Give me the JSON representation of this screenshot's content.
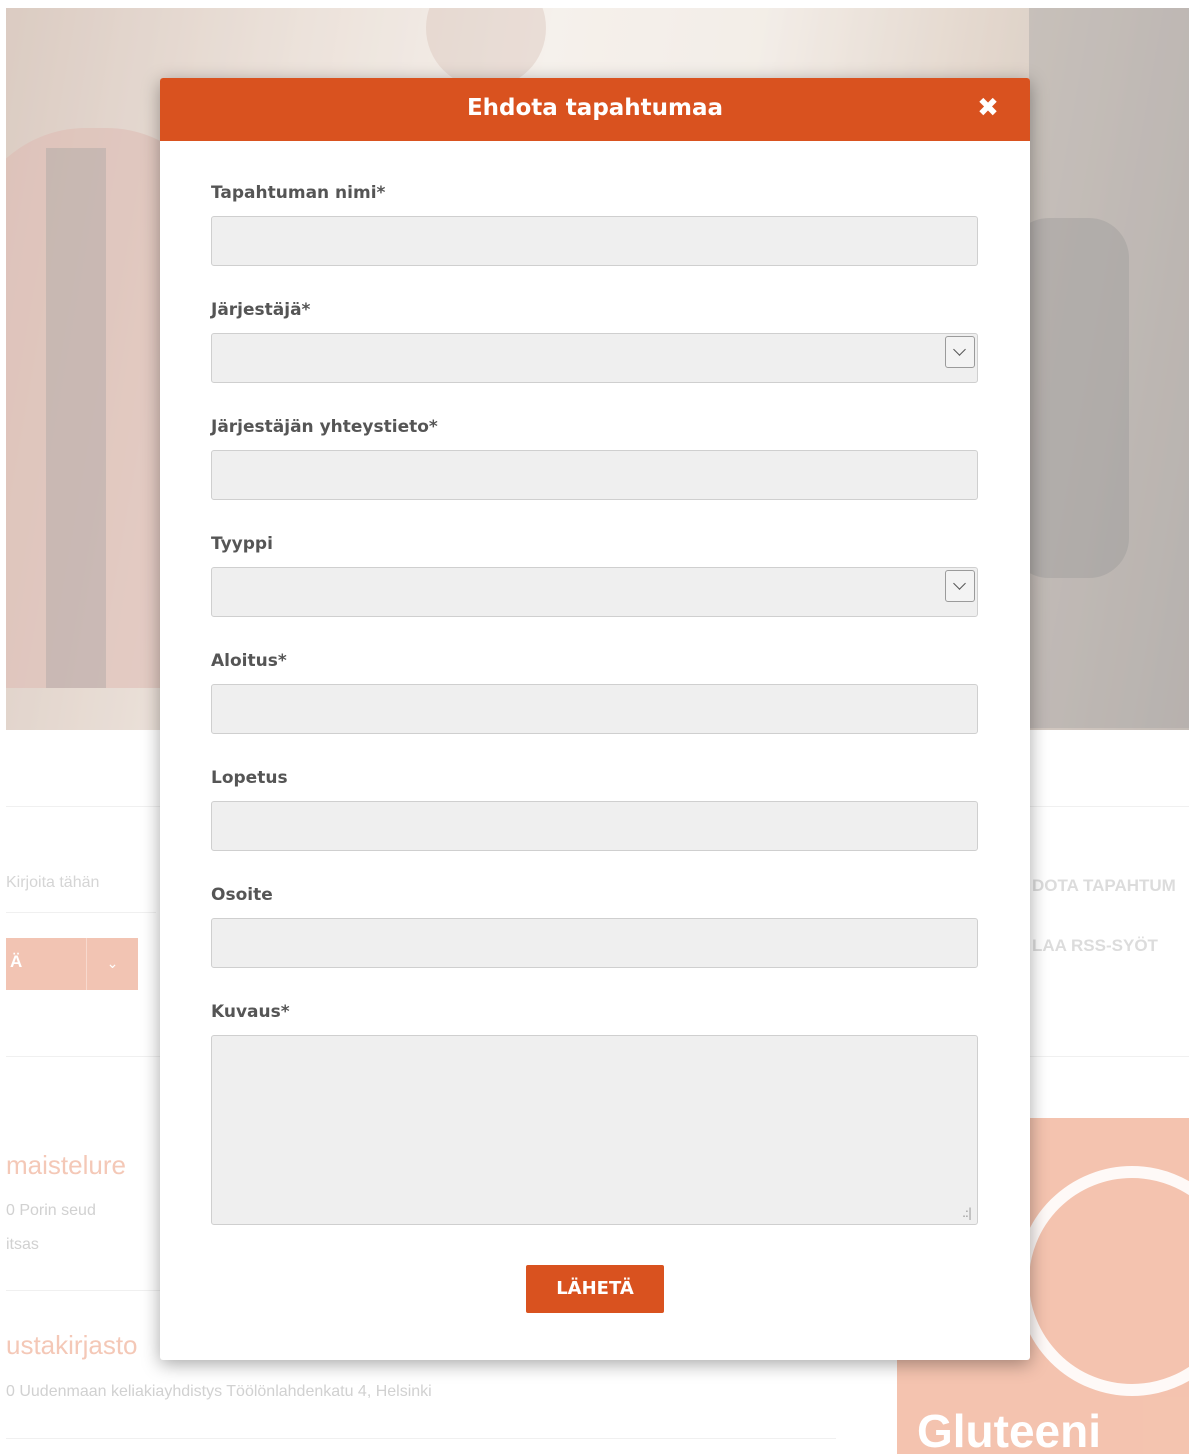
{
  "background": {
    "search_placeholder": "Kirjoita tähän",
    "filter_button_label": "Ä",
    "right_links": [
      "DOTA TAPAHTUM",
      "LAA RSS-SYÖT"
    ],
    "events": [
      {
        "title": "maistelure",
        "meta": "0  Porin seud",
        "meta2": "itsas"
      },
      {
        "title": "ustakirjasto",
        "meta": "0  Uudenmaan keliakiayhdistys   Töölönlahdenkatu 4, Helsinki"
      }
    ],
    "promo_text": "Gluteeni"
  },
  "modal": {
    "title": "Ehdota tapahtumaa",
    "close_glyph": "✖",
    "fields": {
      "name": {
        "label": "Tapahtuman nimi*",
        "value": ""
      },
      "organizer": {
        "label": "Järjestäjä*",
        "value": ""
      },
      "contact": {
        "label": "Järjestäjän yhteystieto*",
        "value": ""
      },
      "type": {
        "label": "Tyyppi",
        "value": ""
      },
      "start": {
        "label": "Aloitus*",
        "value": ""
      },
      "end": {
        "label": "Lopetus",
        "value": ""
      },
      "address": {
        "label": "Osoite",
        "value": ""
      },
      "description": {
        "label": "Kuvaus*",
        "value": ""
      }
    },
    "submit_label": "LÄHETÄ"
  },
  "colors": {
    "accent": "#d9521f",
    "input_bg": "#efefef"
  }
}
